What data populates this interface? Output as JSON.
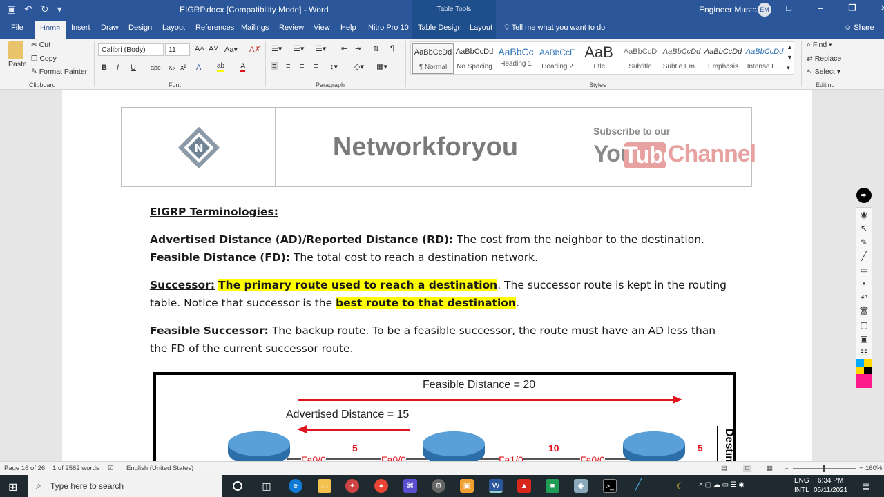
{
  "titlebar": {
    "doc_title": "EIGRP.docx [Compatibility Mode]  -  Word",
    "table_tools": "Table Tools",
    "user": "Engineer Mustafa",
    "avatar_initials": "EM"
  },
  "tabs": [
    "File",
    "Home",
    "Insert",
    "Draw",
    "Design",
    "Layout",
    "References",
    "Mailings",
    "Review",
    "View",
    "Help",
    "Nitro Pro 10",
    "Table Design",
    "Layout"
  ],
  "tellme": "Tell me what you want to do",
  "share": "Share",
  "clipboard": {
    "paste": "Paste",
    "cut": "Cut",
    "copy": "Copy",
    "format_painter": "Format Painter",
    "label": "Clipboard"
  },
  "font": {
    "name": "Calibri (Body)",
    "size": "11",
    "label": "Font"
  },
  "paragraph": {
    "label": "Paragraph"
  },
  "styles": {
    "label": "Styles",
    "items": [
      {
        "preview": "AaBbCcDd",
        "name": "¶ Normal"
      },
      {
        "preview": "AaBbCcDd",
        "name": "No Spacing"
      },
      {
        "preview": "AaBbCc",
        "name": "Heading 1"
      },
      {
        "preview": "AaBbCcE",
        "name": "Heading 2"
      },
      {
        "preview": "AaB",
        "name": "Title"
      },
      {
        "preview": "AaBbCcD",
        "name": "Subtitle"
      },
      {
        "preview": "AaBbCcDd",
        "name": "Subtle Em..."
      },
      {
        "preview": "AaBbCcDd",
        "name": "Emphasis"
      },
      {
        "preview": "AaBbCcDd",
        "name": "Intense E..."
      }
    ]
  },
  "editing": {
    "find": "Find",
    "replace": "Replace",
    "select": "Select",
    "label": "Editing"
  },
  "banner": {
    "brand": "Networkforyou",
    "subscribe": "Subscribe to our",
    "you": "You",
    "tube": "Tube",
    "channel": "Channel"
  },
  "doc": {
    "heading": "EIGRP Terminologies:",
    "ad_term": "Advertised Distance (AD)/Reported Distance (RD):",
    "ad_def": " The cost from the neighbor to the destination.",
    "fd_term": "Feasible Distance (FD):",
    "fd_def": " The total cost to reach a destination network.",
    "succ_term": "Successor:",
    "succ_hl1": "The primary route used to reach a destination",
    "succ_rest1": ". The successor route is kept in the routing",
    "succ_line2": "table. Notice that successor is the ",
    "succ_hl2": "best route to that destination",
    "succ_end": ".",
    "fs_term": "Feasible Successor:",
    "fs_def1": " The backup route. To be a feasible successor, the route must have an AD less than",
    "fs_def2": "the FD of the current successor route."
  },
  "figure": {
    "fd_label": "Feasible Distance = 20",
    "ad_label": "Advertised Distance = 15",
    "ports": [
      "Fa0/0",
      "Fa0/0",
      "Fa1/0",
      "Fa0/0"
    ],
    "costs": [
      "5",
      "10",
      "5"
    ],
    "dest": "Destin"
  },
  "status": {
    "page": "Page 16 of 26",
    "words": "1 of 2562 words",
    "language": "English (United States)",
    "zoom": "160%"
  },
  "taskbar": {
    "search": "Type here to search",
    "lang1": "ENG",
    "lang2": "INTL",
    "time": "6:34 PM",
    "date": "05/11/2021"
  }
}
